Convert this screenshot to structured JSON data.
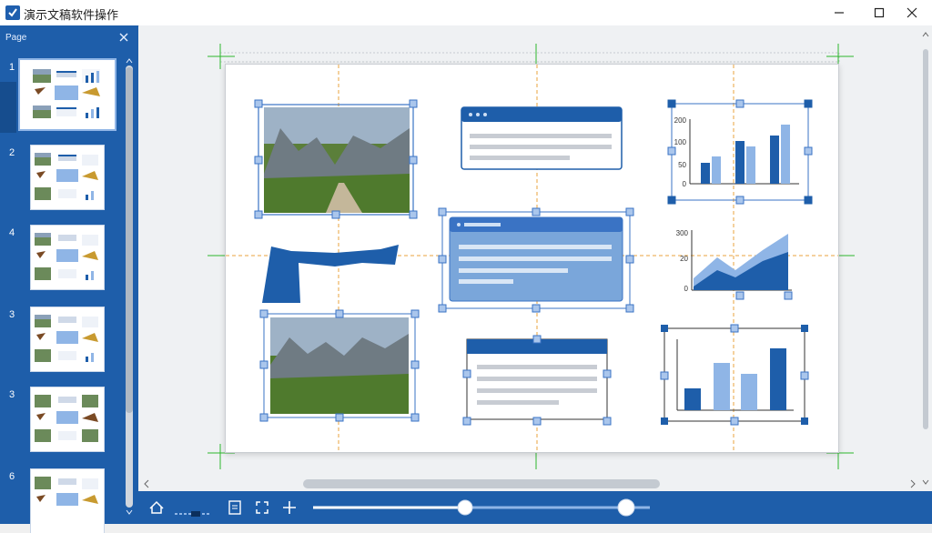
{
  "app": {
    "title": "演示文稿软件操作"
  },
  "sidebar": {
    "title": "Page",
    "thumbnails": [
      {
        "number": "1",
        "selected": true
      },
      {
        "number": "2",
        "selected": false
      },
      {
        "number": "4",
        "selected": false
      },
      {
        "number": "3",
        "selected": false
      },
      {
        "number": "3",
        "selected": false
      },
      {
        "number": "6",
        "selected": false
      }
    ]
  },
  "slide": {
    "bar_chart": {
      "ticks": [
        "200",
        "100",
        "50",
        "0"
      ]
    },
    "area_chart": {
      "ticks": [
        "300",
        "20",
        "0"
      ]
    }
  },
  "zoom": {
    "slider_fraction": 0.45
  },
  "icons": {
    "app": "app-logo-icon",
    "minimize": "minimize-icon",
    "maximize": "maximize-icon",
    "close": "close-icon",
    "sidebar_close": "close-icon",
    "home": "home-icon",
    "notes": "notes-icon",
    "fit": "fit-icon",
    "add": "plus-icon"
  },
  "colors": {
    "accent": "#1e5eaa",
    "selection": "#3a73c4",
    "guide_orange": "#e8a33c",
    "guide_green": "#2eb82e"
  }
}
